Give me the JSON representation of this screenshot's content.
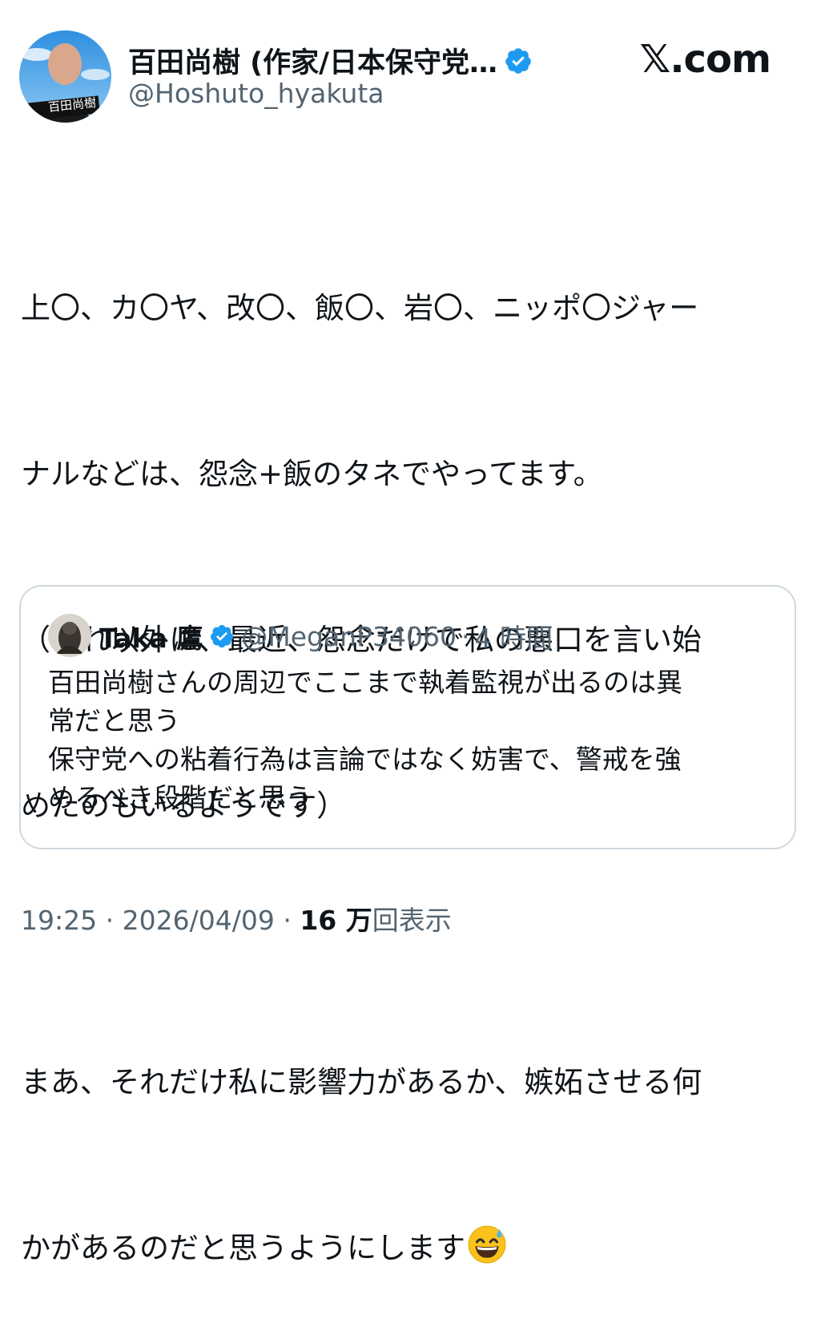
{
  "author": {
    "display_name": "百田尚樹 (作家/日本保守党…",
    "handle": "@Hoshuto_hyakuta",
    "avatar_caption": "百田尚樹",
    "verified_icon": "verified-badge-icon"
  },
  "brand": {
    "label": "𝕏.com"
  },
  "tweet": {
    "lines": [
      "上〇、カ〇ヤ、改〇、飯〇、岩〇、ニッポ〇ジャー",
      "ナルなどは、怨念+飯のタネでやってます。",
      "（これ以外に、最近、怨念だけで私の悪口を言い始",
      "めたのもいるようです）",
      "",
      "まあ、それだけ私に影響力があるか、嫉妬させる何",
      "かがあるのだと思うようにします"
    ],
    "emoji": "grinning-face-with-sweat-icon"
  },
  "quote": {
    "display_name": "Taka 鷹",
    "handle": "@MeganP34060",
    "separator": "·",
    "time": "4 時間",
    "lines": [
      "百田尚樹さんの周辺でここまで執着監視が出るのは異",
      "常だと思う",
      "保守党への粘着行為は言論ではなく妨害で、警戒を強",
      "めるべき段階だと思う"
    ]
  },
  "meta": {
    "time": "19:25",
    "sep1": "·",
    "date": "2026/04/09",
    "sep2": "·",
    "views_count": "16 万",
    "views_label": "回表示"
  },
  "colors": {
    "text": "#0f1419",
    "secondary": "#536471",
    "verified": "#1d9bf0",
    "border": "#cfd9de"
  }
}
